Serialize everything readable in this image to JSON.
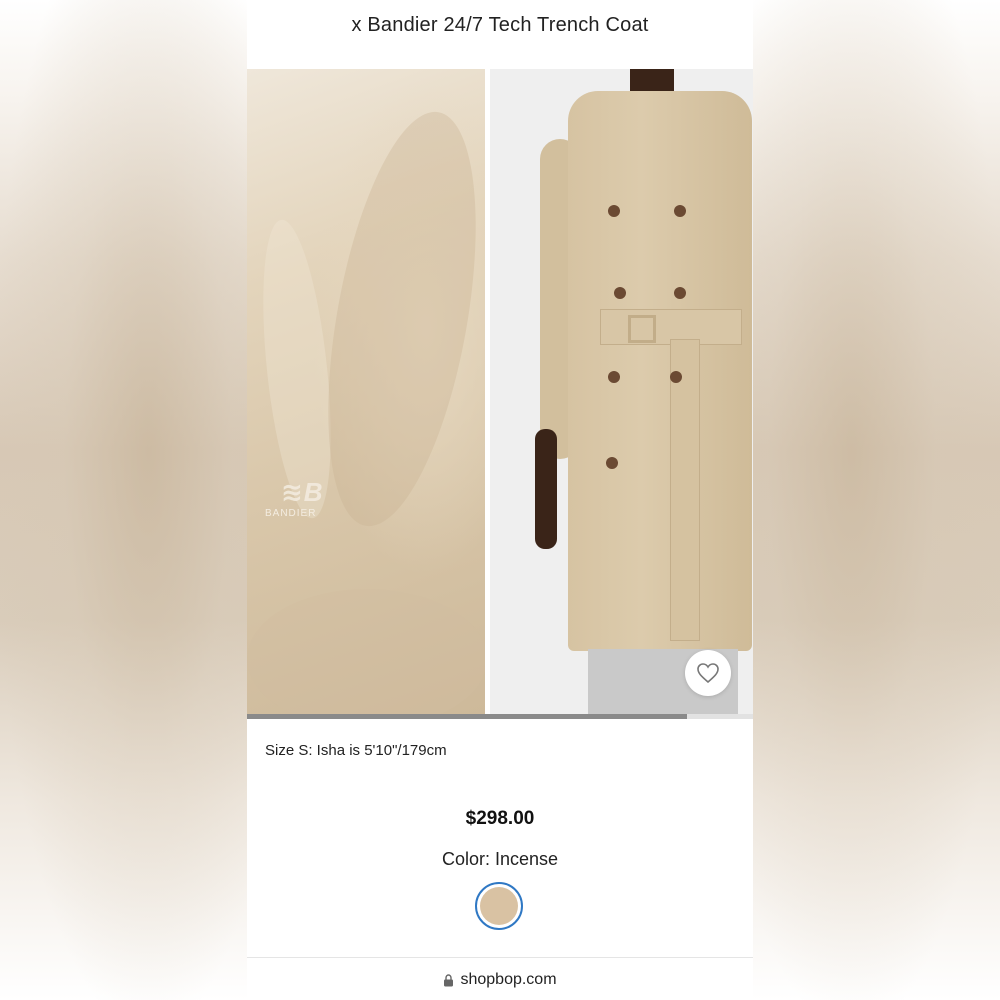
{
  "product": {
    "title": "x Bandier 24/7 Tech Trench Coat",
    "size_note": "Size S: Isha is 5'10\"/179cm",
    "price": "$298.00",
    "color_label": "Color: Incense",
    "swatch_color": "#d9c2a3"
  },
  "gallery": {
    "progress": 0.87,
    "logo_text": "BANDIER",
    "favorite_icon": "heart-outline-icon"
  },
  "browser": {
    "url": "shopbop.com",
    "lock_icon": "lock-icon"
  },
  "colors": {
    "accent_ring": "#2f78c4"
  }
}
